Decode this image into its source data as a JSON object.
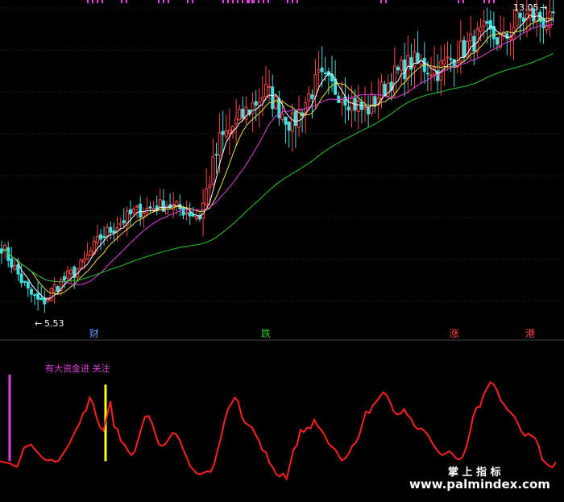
{
  "chart_data": [
    {
      "type": "candlestick",
      "y_ticks_visible": false,
      "annotations": {
        "high_label": "13.05",
        "low_label": "5.53",
        "event_labels": [
          {
            "text": "财",
            "color": "#5aa0ff",
            "bar_index": 28
          },
          {
            "text": "跌",
            "color": "#22cc22",
            "bar_index": 80
          },
          {
            "text": "涨",
            "color": "#ff4444",
            "bar_index": 137
          },
          {
            "text": "港",
            "color": "#ff4444",
            "bar_index": 160
          }
        ]
      },
      "trend_close": [
        [
          0,
          7.4
        ],
        [
          8,
          6.3
        ],
        [
          12,
          6.0
        ],
        [
          16,
          6.4
        ],
        [
          24,
          6.9
        ],
        [
          30,
          7.6
        ],
        [
          40,
          8.2
        ],
        [
          50,
          8.4
        ],
        [
          60,
          8.1
        ],
        [
          66,
          9.9
        ],
        [
          74,
          10.6
        ],
        [
          80,
          11.1
        ],
        [
          88,
          10.3
        ],
        [
          96,
          11.4
        ],
        [
          104,
          11.0
        ],
        [
          110,
          10.6
        ],
        [
          118,
          11.4
        ],
        [
          124,
          11.8
        ],
        [
          132,
          11.6
        ],
        [
          138,
          12.0
        ],
        [
          146,
          12.5
        ],
        [
          152,
          12.3
        ],
        [
          156,
          12.8
        ],
        [
          160,
          12.9
        ],
        [
          167,
          12.7
        ]
      ],
      "series_colors": {
        "up": "#ff4444",
        "down": "#40e0e0",
        "ma_fast": "#ffffff",
        "ma_mid": "#e8e040",
        "ma_slow": "#e040e0",
        "ma_long": "#22cc22"
      }
    },
    {
      "type": "line",
      "legend_text": "有大资金进 关注",
      "line_color": "#ff2020",
      "values": [
        50,
        49,
        48,
        47,
        44,
        43,
        55,
        68,
        70,
        72,
        66,
        61,
        56,
        52,
        51,
        52,
        49,
        51,
        58,
        65,
        72,
        82,
        91,
        99,
        112,
        117,
        133,
        125,
        106,
        94,
        90,
        110,
        128,
        95,
        92,
        76,
        72,
        64,
        58,
        62,
        78,
        94,
        108,
        109,
        100,
        85,
        72,
        70,
        73,
        80,
        87,
        85,
        78,
        66,
        56,
        44,
        39,
        34,
        33,
        35,
        37,
        36,
        46,
        64,
        81,
        102,
        118,
        125,
        133,
        128,
        108,
        100,
        97,
        94,
        85,
        77,
        64,
        62,
        48,
        42,
        33,
        30,
        34,
        27,
        46,
        65,
        71,
        91,
        88,
        94,
        93,
        104,
        96,
        91,
        84,
        74,
        69,
        66,
        58,
        51,
        54,
        60,
        70,
        74,
        83,
        100,
        115,
        113,
        123,
        128,
        134,
        140,
        136,
        127,
        115,
        111,
        112,
        118,
        110,
        106,
        96,
        92,
        93,
        89,
        84,
        75,
        68,
        62,
        58,
        60,
        63,
        60,
        54,
        52,
        56,
        68,
        86,
        108,
        120,
        121,
        136,
        145,
        153,
        150,
        142,
        129,
        124,
        117,
        113,
        108,
        99,
        89,
        83,
        86,
        83,
        80,
        70,
        52,
        48,
        44,
        42,
        49
      ],
      "signals": [
        {
          "color": "#e040e0",
          "index": 1,
          "value_low": 50,
          "value_high": 163
        },
        {
          "color": "#ffff00",
          "index": 31,
          "value_low": 50,
          "value_high": 150
        }
      ]
    }
  ],
  "watermark": {
    "title": "掌 上 指 标",
    "url": "www.palmindex.com"
  }
}
